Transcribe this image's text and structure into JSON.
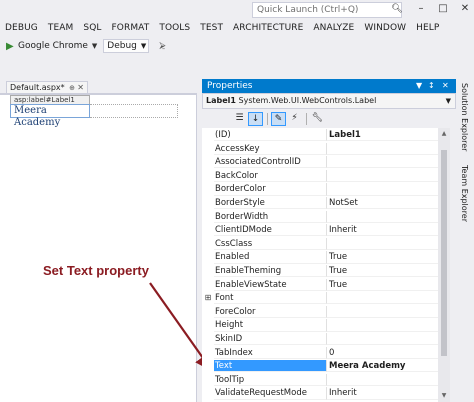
{
  "title_bar": {
    "quick_launch_placeholder": "Quick Launch (Ctrl+Q)",
    "search_icon": "search-icon"
  },
  "menu": [
    "DEBUG",
    "TEAM",
    "SQL",
    "FORMAT",
    "TOOLS",
    "TEST",
    "ARCHITECTURE",
    "ANALYZE",
    "WINDOW",
    "HELP"
  ],
  "toolbar": {
    "run_target": "Google Chrome",
    "configuration": "Debug"
  },
  "document": {
    "tab_label": "Default.aspx*",
    "tag_hint": "asp:label#Label1",
    "label_text": "Meera Academy"
  },
  "annotation": {
    "text": "Set Text property",
    "color": "#8b1c22"
  },
  "properties": {
    "title": "Properties",
    "object_name": "Label1",
    "object_type": "System.Web.UI.WebControls.Label",
    "accent": "#007acc",
    "rows": [
      {
        "name": "(ID)",
        "value": "Label1",
        "bold": true
      },
      {
        "name": "AccessKey",
        "value": ""
      },
      {
        "name": "AssociatedControlID",
        "value": ""
      },
      {
        "name": "BackColor",
        "value": ""
      },
      {
        "name": "BorderColor",
        "value": ""
      },
      {
        "name": "BorderStyle",
        "value": "NotSet"
      },
      {
        "name": "BorderWidth",
        "value": ""
      },
      {
        "name": "ClientIDMode",
        "value": "Inherit"
      },
      {
        "name": "CssClass",
        "value": ""
      },
      {
        "name": "Enabled",
        "value": "True"
      },
      {
        "name": "EnableTheming",
        "value": "True"
      },
      {
        "name": "EnableViewState",
        "value": "True"
      },
      {
        "name": "Font",
        "value": "",
        "expandable": true
      },
      {
        "name": "ForeColor",
        "value": ""
      },
      {
        "name": "Height",
        "value": ""
      },
      {
        "name": "SkinID",
        "value": ""
      },
      {
        "name": "TabIndex",
        "value": "0"
      },
      {
        "name": "Text",
        "value": "Meera Academy",
        "selected": true
      },
      {
        "name": "ToolTip",
        "value": ""
      },
      {
        "name": "ValidateRequestMode",
        "value": "Inherit"
      }
    ]
  },
  "side_tabs": [
    "Solution Explorer",
    "Team Explorer"
  ]
}
